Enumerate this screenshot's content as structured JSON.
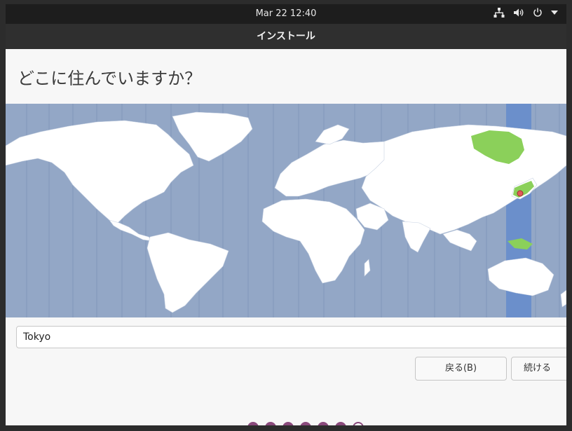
{
  "top_bar": {
    "clock": "Mar 22  12:40",
    "icons": [
      "network-icon",
      "volume-icon",
      "power-icon",
      "chevron-down-icon"
    ]
  },
  "window": {
    "title": "インストール",
    "heading": "どこに住んでいますか？",
    "location_input": {
      "value": "Tokyo"
    },
    "buttons": {
      "back": "戻る(B)",
      "next": "続ける"
    },
    "progress_dots": {
      "total": 7,
      "current": 7
    }
  },
  "map": {
    "selected_city": "Tokyo",
    "colors": {
      "ocean": "#93a7c6",
      "land": "#ffffff",
      "selected_zone_band": "#6b8fcb",
      "highlighted_land": "#8bd05a",
      "marker": "#e05a5a"
    }
  }
}
